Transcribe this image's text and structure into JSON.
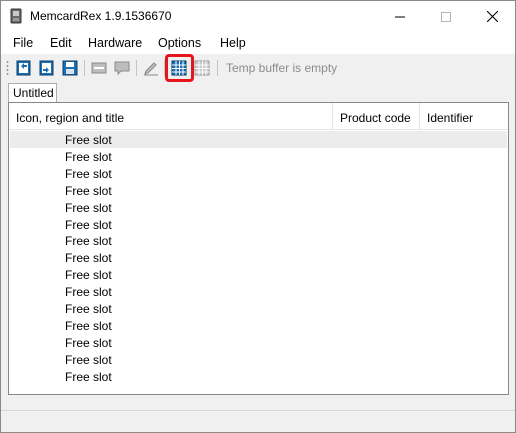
{
  "window": {
    "title": "MemcardRex 1.9.1536670"
  },
  "menu": {
    "items": [
      "File",
      "Edit",
      "Hardware",
      "Options",
      "Help"
    ]
  },
  "toolbar": {
    "icons": [
      "new-card-icon",
      "open-card-icon",
      "save-card-icon",
      "slot-view-icon",
      "comment-icon",
      "edit-icon",
      "memory-grid-icon",
      "temp-grid-icon"
    ],
    "temp_buffer_text": "Temp buffer is empty",
    "highlight_color": "#e8141c"
  },
  "tabs": [
    {
      "label": "Untitled",
      "active": true
    }
  ],
  "list": {
    "columns": [
      "Icon, region and title",
      "Product code",
      "Identifier"
    ],
    "rows": [
      "Free slot",
      "Free slot",
      "Free slot",
      "Free slot",
      "Free slot",
      "Free slot",
      "Free slot",
      "Free slot",
      "Free slot",
      "Free slot",
      "Free slot",
      "Free slot",
      "Free slot",
      "Free slot",
      "Free slot"
    ],
    "selected_index": 0
  }
}
